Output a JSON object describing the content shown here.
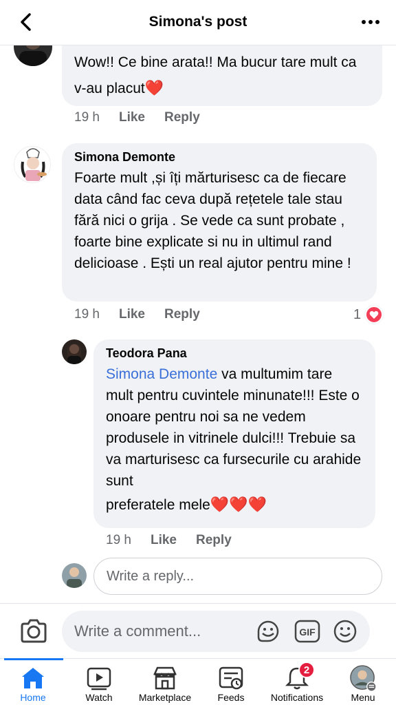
{
  "header": {
    "title": "Simona's post"
  },
  "comments": [
    {
      "author": "",
      "text": "Wow!! Ce bine arata!! Ma bucur tare mult ca v-au placut",
      "emoji": "❤️",
      "time": "19 h",
      "like_label": "Like",
      "reply_label": "Reply"
    },
    {
      "author": "Simona Demonte",
      "text": "Foarte mult ,și îți mărturisesc ca de fiecare data când fac ceva după rețetele tale stau fără nici o grija . Se vede ca sunt probate , foarte bine explicate si nu in ultimul rand delicioase . Ești un real ajutor pentru mine !",
      "time": "19 h",
      "like_label": "Like",
      "reply_label": "Reply",
      "reaction_count": "1",
      "reaction_icon": "heart-reaction"
    }
  ],
  "reply": {
    "author": "Teodora Pana",
    "mention": "Simona Demonte",
    "text": " va multumim tare mult pentru cuvintele minunate!!! Este o onoare pentru noi sa ne vedem produsele in vitrinele dulci!!! Trebuie sa va marturisesc ca fursecurile cu arahide sunt",
    "text_last_line": "preferatele mele",
    "emoji": "❤️❤️❤️",
    "time": "19 h",
    "like_label": "Like",
    "reply_label": "Reply"
  },
  "reply_input": {
    "placeholder": "Write a reply..."
  },
  "composer": {
    "placeholder": "Write a comment...",
    "icons": [
      "camera-icon",
      "sticker-icon",
      "gif-icon",
      "emoji-icon"
    ]
  },
  "tabbar": {
    "tabs": [
      {
        "label": "Home",
        "icon": "home-icon",
        "active": true
      },
      {
        "label": "Watch",
        "icon": "watch-icon"
      },
      {
        "label": "Marketplace",
        "icon": "marketplace-icon"
      },
      {
        "label": "Feeds",
        "icon": "feeds-icon"
      },
      {
        "label": "Notifications",
        "icon": "bell-icon",
        "badge": "2"
      },
      {
        "label": "Menu",
        "icon": "menu-avatar"
      }
    ]
  },
  "colors": {
    "accent": "#1877f2",
    "bubble": "#f0f2f5",
    "mention": "#3a6fd8",
    "badge": "#e41e3f",
    "secondary_text": "#65676b"
  }
}
